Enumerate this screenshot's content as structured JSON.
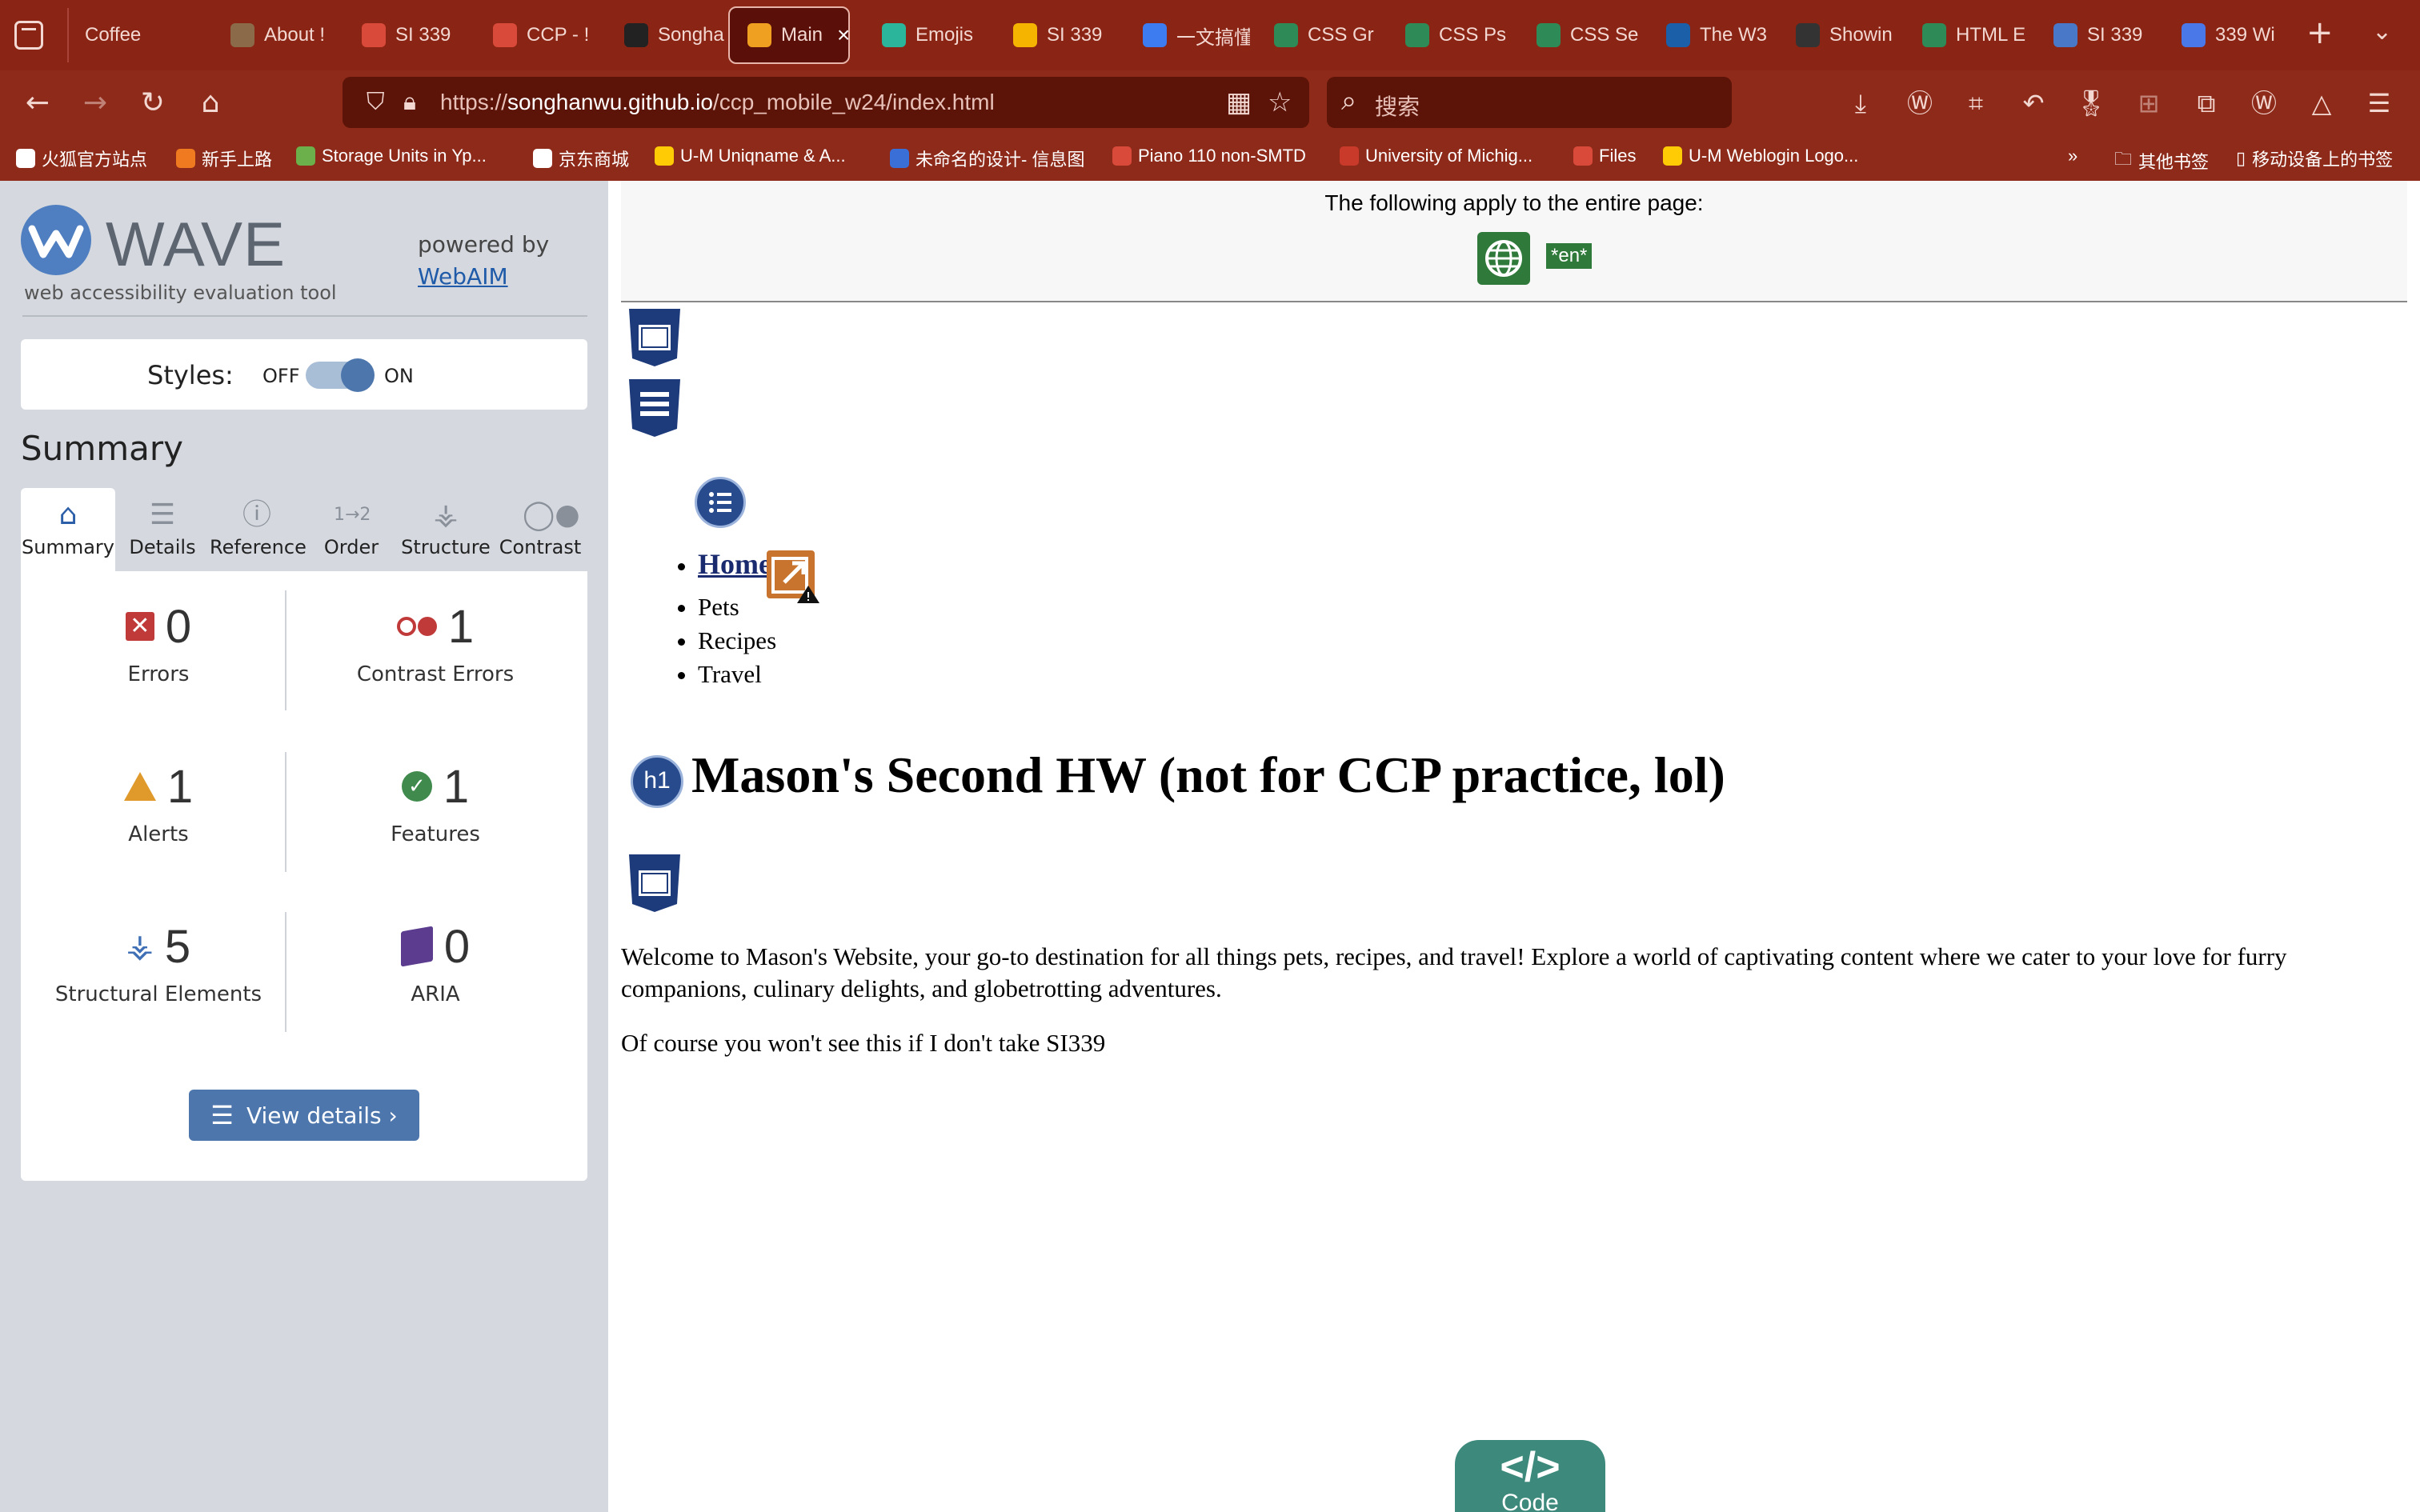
{
  "browser": {
    "tabs": [
      {
        "label": "Coffee",
        "icon": "folder-icon",
        "color": "#8a2415"
      },
      {
        "label": "About !",
        "icon": "image-icon",
        "color": "#8b6a4a"
      },
      {
        "label": "SI 339",
        "icon": "um-icon",
        "color": "#d94a3a"
      },
      {
        "label": "CCP - !",
        "icon": "um-icon",
        "color": "#d94a3a"
      },
      {
        "label": "Songha",
        "icon": "github-icon",
        "color": "#222222"
      },
      {
        "label": "Main",
        "icon": "pet-icon",
        "color": "#f0a020"
      },
      {
        "label": "Emojis",
        "icon": "emoji-icon",
        "color": "#2bb59a"
      },
      {
        "label": "SI 339",
        "icon": "slides-icon",
        "color": "#f4b400"
      },
      {
        "label": "一文搞懂",
        "icon": "juejin-icon",
        "color": "#3c7cf0"
      },
      {
        "label": "CSS Gr",
        "icon": "w3-icon",
        "color": "#2e8b57"
      },
      {
        "label": "CSS Ps",
        "icon": "w3-icon",
        "color": "#2e8b57"
      },
      {
        "label": "CSS Se",
        "icon": "w3-icon",
        "color": "#2e8b57"
      },
      {
        "label": "The W3",
        "icon": "w3c-icon",
        "color": "#1a5fa8"
      },
      {
        "label": "Showin",
        "icon": "nu-icon",
        "color": "#333333"
      },
      {
        "label": "HTML E",
        "icon": "w3-icon",
        "color": "#2e8b57"
      },
      {
        "label": "SI 339",
        "icon": "p-icon",
        "color": "#4a78c8"
      },
      {
        "label": "339 Wi",
        "icon": "docs-icon",
        "color": "#4a78e8"
      }
    ],
    "active_tab_index": 5,
    "url_prefix": "https://",
    "url_host": "songhanwu.github.io",
    "url_path": "/ccp_mobile_w24/index.html",
    "search_placeholder": "搜索",
    "bookmarks": [
      {
        "label": "火狐官方站点",
        "icon": "folder-icon"
      },
      {
        "label": "新手上路",
        "icon": "firefox-icon"
      },
      {
        "label": "Storage Units in Yp...",
        "icon": "exr-icon"
      },
      {
        "label": "京东商城",
        "icon": "globe-icon"
      },
      {
        "label": "U-M Uniqname & A...",
        "icon": "um-logo-icon"
      },
      {
        "label": "未命名的设计- 信息图",
        "icon": "canva-icon"
      },
      {
        "label": "Piano 110 non-SMTD",
        "icon": "um-icon"
      },
      {
        "label": "University of Michig...",
        "icon": "gmail-icon"
      },
      {
        "label": "Files",
        "icon": "um-icon"
      },
      {
        "label": "U-M Weblogin Logo...",
        "icon": "um-logo-icon"
      }
    ],
    "bookmarks_right": [
      "其他书签",
      "移动设备上的书签"
    ]
  },
  "wave": {
    "title": "WAVE",
    "subtitle": "web accessibility evaluation tool",
    "powered_by": "powered by",
    "powered_link": "WebAIM",
    "styles_label": "Styles:",
    "styles_off": "OFF",
    "styles_on": "ON",
    "summary_heading": "Summary",
    "tabs": [
      "Summary",
      "Details",
      "Reference",
      "Order",
      "Structure",
      "Contrast"
    ],
    "stats": {
      "errors": {
        "value": "0",
        "label": "Errors"
      },
      "contrast_errors": {
        "value": "1",
        "label": "Contrast Errors"
      },
      "alerts": {
        "value": "1",
        "label": "Alerts"
      },
      "features": {
        "value": "1",
        "label": "Features"
      },
      "structural": {
        "value": "5",
        "label": "Structural Elements"
      },
      "aria": {
        "value": "0",
        "label": "ARIA"
      }
    },
    "view_details": "View details ›"
  },
  "page": {
    "notice": "The following apply to the entire page:",
    "lang_badge": "*en*",
    "nav": [
      "Home",
      "Pets",
      "Recipes",
      "Travel"
    ],
    "h1_badge": "h1",
    "heading": "Mason's Second HW (not for CCP practice, lol)",
    "paragraph1": "Welcome to Mason's Website, your go-to destination for all things pets, recipes, and travel! Explore a world of captivating content where we cater to your love for furry companions, culinary delights, and globetrotting adventures.",
    "paragraph2": "Of course you won't see this if I don't take SI339",
    "code_tab_glyph": "</>",
    "code_tab_label": "Code"
  }
}
